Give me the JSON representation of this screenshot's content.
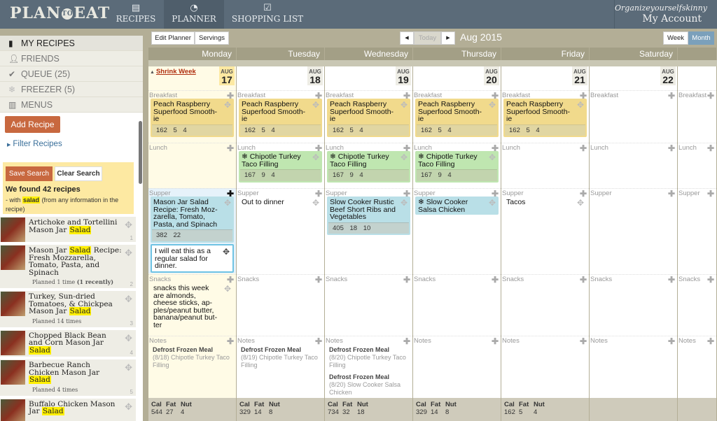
{
  "header": {
    "logo_left": "PLAN",
    "logo_mid": "TO",
    "logo_right": "EAT",
    "nav": [
      {
        "label": "RECIPES",
        "icon": "recipe-cards-icon"
      },
      {
        "label": "PLANNER",
        "icon": "clock-icon"
      },
      {
        "label": "SHOPPING LIST",
        "icon": "checkbox-icon"
      }
    ],
    "account_user": "Organizeyourselfskinny",
    "account_label": "My Account"
  },
  "sidebar": {
    "items": [
      {
        "label": "MY RECIPES",
        "icon": "book-icon"
      },
      {
        "label": "FRIENDS",
        "icon": "person-icon"
      },
      {
        "label": "QUEUE (25)",
        "icon": "check-icon"
      },
      {
        "label": "FREEZER (5)",
        "icon": "snowflake-icon"
      },
      {
        "label": "MENUS",
        "icon": "menu-book-icon"
      }
    ],
    "add_recipe": "Add Recipe",
    "filter_recipes": "Filter Recipes",
    "save_search": "Save Search",
    "clear_search": "Clear Search",
    "found_text": "We found 42 recipes",
    "with_prefix": "- with",
    "search_term": "salad",
    "with_suffix": "(from any information in the recipe)",
    "recipes": [
      {
        "title_pre": "Artichoke and Tortellini Mason Jar",
        "title_hl": "Salad",
        "title_post": "",
        "planned": "",
        "planned_bold": "",
        "num": "1"
      },
      {
        "title_pre": "Mason Jar",
        "title_hl": "Salad",
        "title_post": "Recipe: Fresh Mozzarella, Tomato, Pasta, and Spinach",
        "planned": "Planned 1 time",
        "planned_bold": "(1 recently)",
        "num": "2"
      },
      {
        "title_pre": "Turkey, Sun-dried Tomatoes, & Chickpea Mason Jar",
        "title_hl": "Salad",
        "title_post": "",
        "planned": "Planned 14 times",
        "planned_bold": "",
        "num": "3"
      },
      {
        "title_pre": "Chopped Black Bean and Corn Mason Jar",
        "title_hl": "Salad",
        "title_post": "",
        "planned": "",
        "planned_bold": "",
        "num": "4"
      },
      {
        "title_pre": "Barbecue Ranch Chicken Mason Jar",
        "title_hl": "Salad",
        "title_post": "",
        "planned": "Planned 4 times",
        "planned_bold": "",
        "num": "5"
      },
      {
        "title_pre": "Buffalo Chicken Mason Jar",
        "title_hl": "Salad",
        "title_post": "",
        "planned": "",
        "planned_bold": "",
        "num": ""
      }
    ]
  },
  "toolbar": {
    "edit_planner": "Edit Planner",
    "servings": "Servings",
    "prev": "◀",
    "today": "Today",
    "next": "▶",
    "month_title": "Aug 2015",
    "week": "Week",
    "month": "Month"
  },
  "calendar": {
    "shrink_week": "Shrink Week",
    "slot_labels": {
      "breakfast": "Breakfast",
      "lunch": "Lunch",
      "supper": "Supper",
      "snacks": "Snacks",
      "notes": "Notes"
    },
    "totals_headers": {
      "cal": "Cal",
      "fat": "Fat",
      "nut": "Nut"
    },
    "days": [
      {
        "name": "Monday",
        "month": "AUG",
        "date": "17",
        "breakfast": {
          "title": "Peach Raspberry Superfood Smooth-ie",
          "n": "162 5 4"
        },
        "lunch": null,
        "supper": {
          "title": "Mason Jar Salad Recipe: Fresh Moz-zarella, Tomato, Pasta, and Spinach",
          "n": "382 22"
        },
        "supper_note": "I will eat this as a regular salad for dinner.",
        "snacks_note": "snacks this week are almonds, cheese sticks, ap-ples/peanut butter, banana/peanut but-ter",
        "notes": [
          {
            "title": "Defrost Frozen Meal",
            "body": "(8/18) Chipotle Turkey Taco Filling"
          }
        ],
        "totals": {
          "cal": "544",
          "fat": "27",
          "nut": "4"
        }
      },
      {
        "name": "Tuesday",
        "month": "AUG",
        "date": "18",
        "breakfast": {
          "title": "Peach Raspberry Superfood Smooth-ie",
          "n": "162 5 4"
        },
        "lunch": {
          "title": "Chipotle Turkey Taco Filling",
          "n": "167 9 4"
        },
        "supper_text": "Out to dinner",
        "notes": [
          {
            "title": "Defrost Frozen Meal",
            "body": "(8/19) Chipotle Turkey Taco Filling"
          }
        ],
        "totals": {
          "cal": "329",
          "fat": "14",
          "nut": "8"
        }
      },
      {
        "name": "Wednesday",
        "month": "AUG",
        "date": "19",
        "breakfast": {
          "title": "Peach Raspberry Superfood Smooth-ie",
          "n": "162 5 4"
        },
        "lunch": {
          "title": "Chipotle Turkey Taco Filling",
          "n": "167 9 4"
        },
        "supper": {
          "title": "Slow Cooker Rustic Beef Short Ribs and Vegetables",
          "n": "405 18 10"
        },
        "notes": [
          {
            "title": "Defrost Frozen Meal",
            "body": "(8/20) Chipotle Turkey Taco Filling"
          },
          {
            "title": "Defrost Frozen Meal",
            "body": "(8/20) Slow Cooker Salsa Chicken"
          }
        ],
        "totals": {
          "cal": "734",
          "fat": "32",
          "nut": "18"
        }
      },
      {
        "name": "Thursday",
        "month": "AUG",
        "date": "20",
        "breakfast": {
          "title": "Peach Raspberry Superfood Smooth-ie",
          "n": "162 5 4"
        },
        "lunch": {
          "title": "Chipotle Turkey Taco Filling",
          "n": "167 9 4"
        },
        "supper": {
          "title": "Slow Cooker Salsa Chicken",
          "n": ""
        },
        "notes": [],
        "totals": {
          "cal": "329",
          "fat": "14",
          "nut": "8"
        }
      },
      {
        "name": "Friday",
        "month": "AUG",
        "date": "21",
        "breakfast": {
          "title": "Peach Raspberry Superfood Smooth-ie",
          "n": "162 5 4"
        },
        "supper_text": "Tacos",
        "notes": [],
        "totals": {
          "cal": "162",
          "fat": "5",
          "nut": "4"
        }
      },
      {
        "name": "Saturday",
        "month": "AUG",
        "date": "22",
        "notes": [],
        "totals": null
      },
      {
        "name": "",
        "month": "",
        "date": "",
        "notes": [],
        "totals": null
      }
    ]
  },
  "colors": {
    "header": "#5b6b79",
    "accent_orange": "#c8683f",
    "breakfast_card": "#f1da8c",
    "lunch_card": "#bfe6b0",
    "supper_card": "#b9dfe7",
    "highlight": "#ffef00"
  }
}
